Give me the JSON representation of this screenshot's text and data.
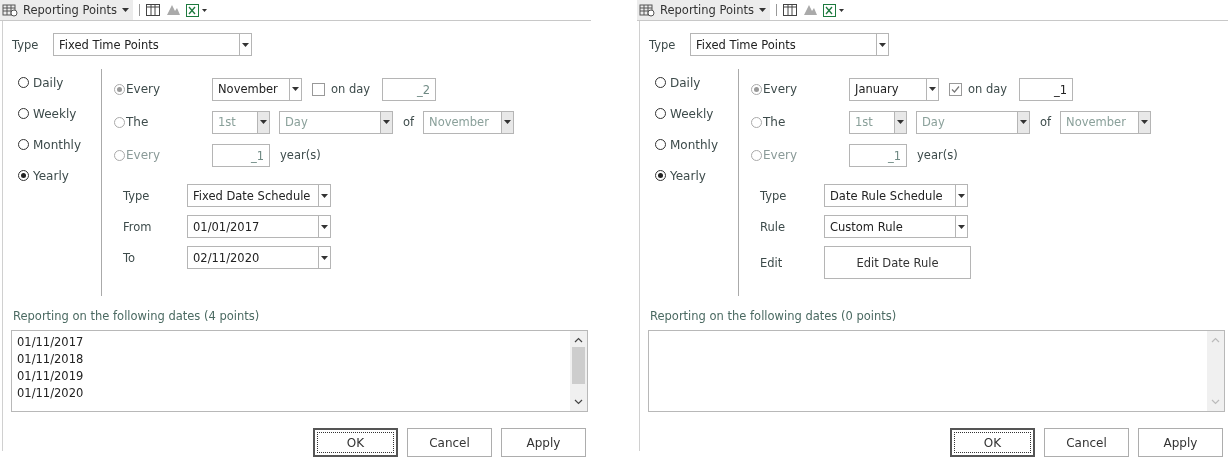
{
  "panels": [
    {
      "tab": {
        "title": "Reporting Points"
      },
      "type_label": "Type",
      "type_value": "Fixed Time Points",
      "frequencies": [
        {
          "label": "Daily",
          "selected": false
        },
        {
          "label": "Weekly",
          "selected": false
        },
        {
          "label": "Monthly",
          "selected": false
        },
        {
          "label": "Yearly",
          "selected": true
        }
      ],
      "every": {
        "label": "Every",
        "selected": true,
        "month": "November",
        "on_day_label": "on day",
        "on_day_checked": false,
        "day": "_2"
      },
      "the": {
        "label": "The",
        "selected": false,
        "ordinal": "1st",
        "day_kind": "Day",
        "of_label": "of",
        "month": "November"
      },
      "every_years": {
        "label": "Every",
        "selected": false,
        "value": "_1",
        "unit": "year(s)"
      },
      "schedule": [
        {
          "kind": "select",
          "label": "Type",
          "value": "Fixed Date Schedule"
        },
        {
          "kind": "select",
          "label": "From",
          "value": "01/01/2017"
        },
        {
          "kind": "select",
          "label": "To",
          "value": "02/11/2020"
        }
      ],
      "dates_label": "Reporting on the following dates (4 points)",
      "dates": [
        "01/11/2017",
        "01/11/2018",
        "01/11/2019",
        "01/11/2020"
      ],
      "buttons": [
        {
          "label": "OK",
          "default": true
        },
        {
          "label": "Cancel",
          "default": false
        },
        {
          "label": "Apply",
          "default": false
        }
      ]
    },
    {
      "tab": {
        "title": "Reporting Points"
      },
      "type_label": "Type",
      "type_value": "Fixed Time Points",
      "frequencies": [
        {
          "label": "Daily",
          "selected": false
        },
        {
          "label": "Weekly",
          "selected": false
        },
        {
          "label": "Monthly",
          "selected": false
        },
        {
          "label": "Yearly",
          "selected": true
        }
      ],
      "every": {
        "label": "Every",
        "selected": true,
        "month": "January",
        "on_day_label": "on day",
        "on_day_checked": true,
        "day": "_1"
      },
      "the": {
        "label": "The",
        "selected": false,
        "ordinal": "1st",
        "day_kind": "Day",
        "of_label": "of",
        "month": "November"
      },
      "every_years": {
        "label": "Every",
        "selected": false,
        "value": "_1",
        "unit": "year(s)"
      },
      "schedule": [
        {
          "kind": "select",
          "label": "Type",
          "value": "Date Rule Schedule"
        },
        {
          "kind": "select",
          "label": "Rule",
          "value": "Custom Rule"
        },
        {
          "kind": "button",
          "label": "Edit",
          "value": "Edit Date Rule"
        }
      ],
      "dates_label": "Reporting on the following dates (0 points)",
      "buttons": [
        {
          "label": "OK",
          "default": true
        },
        {
          "label": "Cancel",
          "default": false
        },
        {
          "label": "Apply",
          "default": false
        }
      ]
    }
  ]
}
